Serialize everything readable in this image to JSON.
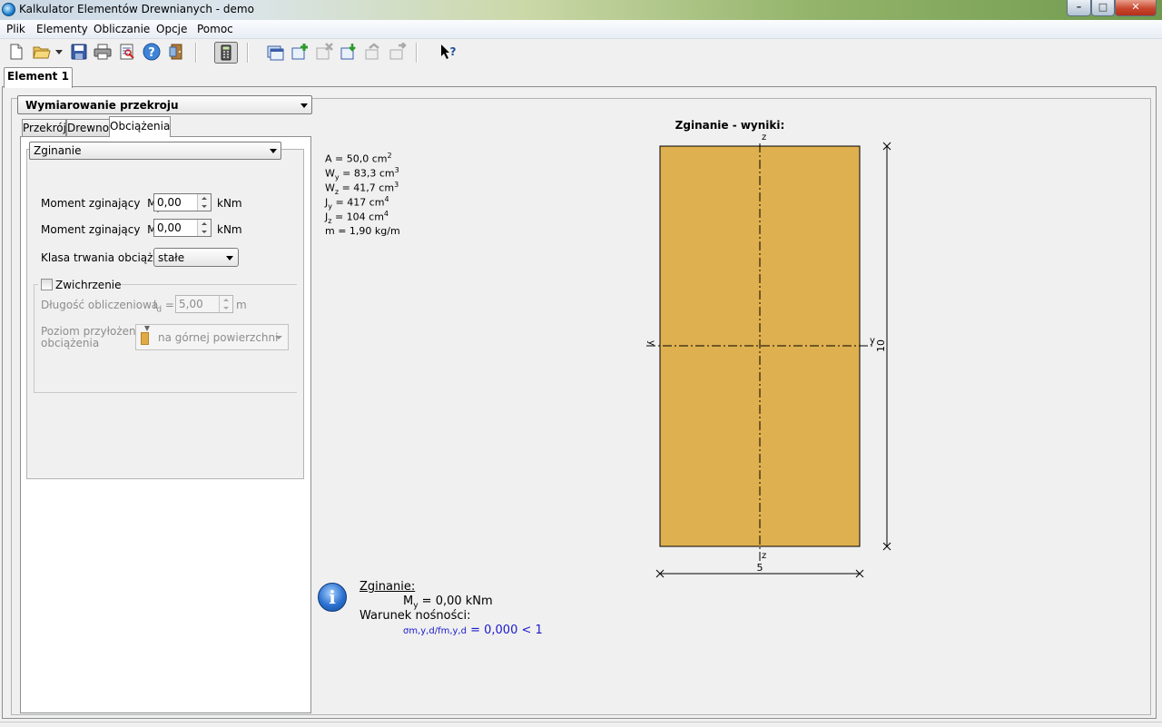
{
  "window": {
    "title": "Kalkulator Elementów Drewnianych - demo",
    "controls": {
      "minimize": "–",
      "maximize": "□",
      "close": "✕"
    }
  },
  "menu": [
    "Plik",
    "Elementy",
    "Obliczanie",
    "Opcje",
    "Pomoc"
  ],
  "toolbar": {
    "icons": [
      "new-file-icon",
      "open-folder-icon",
      "save-icon",
      "print-icon",
      "print-preview-icon",
      "help-icon",
      "exit-icon",
      "calculator-icon",
      "new-element-icon",
      "add-element-icon",
      "delete-element-icon",
      "import-element-icon",
      "export-left-icon",
      "export-right-icon",
      "context-help-icon"
    ]
  },
  "tabs": {
    "element": "Element 1"
  },
  "section_select": "Wymiarowanie przekroju",
  "inner_tabs": [
    "Przekrój",
    "Drewno",
    "Obciążenia"
  ],
  "calc_type": "Zginanie",
  "loads": {
    "moment_label": "Moment zginający",
    "my_sym": "M",
    "my_sub": "y",
    "mz_sym": "M",
    "mz_sub": "z",
    "eq": "=",
    "my_value": "0,00",
    "mz_value": "0,00",
    "unit": "kNm",
    "klasa_label": "Klasa trwania obciążenia",
    "klasa_value": "stałe"
  },
  "zwichrzenie": {
    "label": "Zwichrzenie",
    "checked": false,
    "dlugosc_label": "Długość obliczeniowa",
    "ld_sym": "l",
    "ld_sub": "d",
    "ld_eq": "=",
    "ld_value": "5,00",
    "ld_unit": "m",
    "poziom_label_1": "Poziom  przyłożenia",
    "poziom_label_2": "obciążenia",
    "poziom_value": "na górnej powierzchni"
  },
  "properties": {
    "A": {
      "sym": "A",
      "eq": " = 50,0 cm",
      "sup": "2"
    },
    "Wy": {
      "sym": "W",
      "sub": "y",
      "eq": " = 83,3 cm",
      "sup": "3"
    },
    "Wz": {
      "sym": "W",
      "sub": "z",
      "eq": " = 41,7 cm",
      "sup": "3"
    },
    "Jy": {
      "sym": "J",
      "sub": "y",
      "eq": " = 417 cm",
      "sup": "4"
    },
    "Jz": {
      "sym": "J",
      "sub": "z",
      "eq": " = 104 cm",
      "sup": "4"
    },
    "m": {
      "text": "m = 1,90 kg/m"
    }
  },
  "drawing": {
    "title": "Zginanie - wyniki:",
    "axis_z_top": "z",
    "axis_z_bottom": "z",
    "axis_y_left": "y",
    "axis_y_right": "y",
    "width_dim": "5",
    "height_dim": "10",
    "section_color": "#dfb04f"
  },
  "results": {
    "heading": "Zginanie:",
    "my_sym": "M",
    "my_sub": "y",
    "my_eq": " = 0,00 kNm",
    "condition_label": "Warunek nośności:",
    "formula": "σm,y,d/fm,y,d",
    "formula_value": " = 0,000  <  1",
    "formula_color": "#1a1acd"
  }
}
